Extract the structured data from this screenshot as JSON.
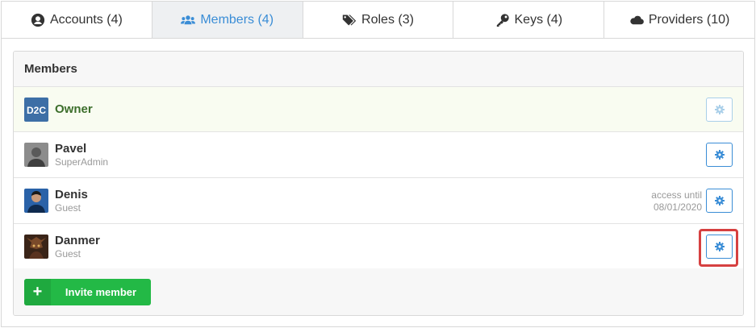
{
  "tabs": [
    {
      "label": "Accounts (4)",
      "icon": "user-circle-icon",
      "active": false
    },
    {
      "label": "Members (4)",
      "icon": "users-icon",
      "active": true
    },
    {
      "label": "Roles (3)",
      "icon": "tags-icon",
      "active": false
    },
    {
      "label": "Keys (4)",
      "icon": "key-icon",
      "active": false
    },
    {
      "label": "Providers (10)",
      "icon": "cloud-icon",
      "active": false
    }
  ],
  "panel": {
    "title": "Members"
  },
  "members": [
    {
      "name": "Owner",
      "role": "",
      "avatar": "d2c-logo",
      "access": ""
    },
    {
      "name": "Pavel",
      "role": "SuperAdmin",
      "avatar": "photo-pavel",
      "access": ""
    },
    {
      "name": "Denis",
      "role": "Guest",
      "avatar": "photo-denis",
      "access_line1": "access until",
      "access_line2": "08/01/2020"
    },
    {
      "name": "Danmer",
      "role": "Guest",
      "avatar": "photo-danmer",
      "access": ""
    }
  ],
  "footer": {
    "invite_label": "Invite member",
    "invite_icon": "+"
  },
  "colors": {
    "accent": "#3a8dd6",
    "green": "#23b946",
    "owner_text": "#3c6e2b",
    "highlight": "#d64040",
    "owner_bg": "#f9fcf1"
  },
  "logo_text": "D2C"
}
